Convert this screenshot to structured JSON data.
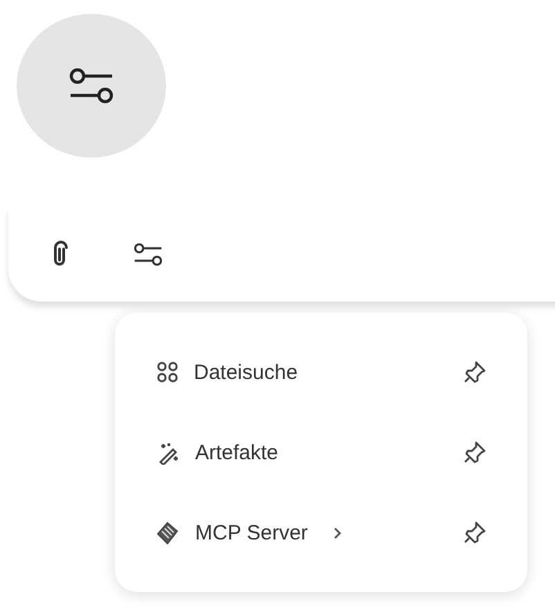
{
  "menu": {
    "items": [
      {
        "kind": "search",
        "label": "Dateisuche",
        "submenu": false
      },
      {
        "kind": "artifact",
        "label": "Artefakte",
        "submenu": false
      },
      {
        "kind": "server",
        "label": "MCP Server",
        "submenu": true
      }
    ]
  }
}
